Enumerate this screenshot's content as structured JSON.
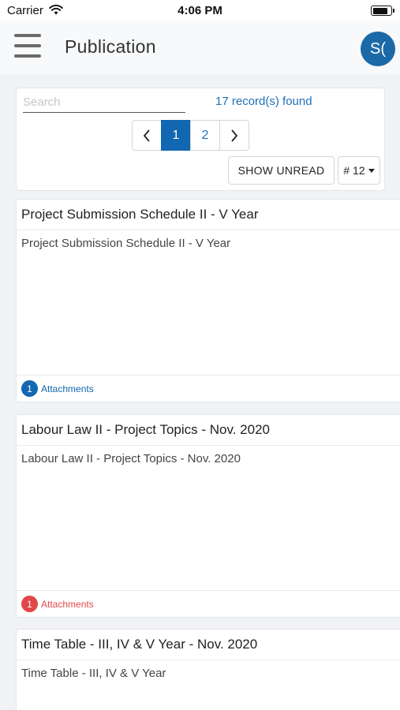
{
  "status_bar": {
    "carrier": "Carrier",
    "time": "4:06 PM",
    "battery_level": 0.9
  },
  "app_bar": {
    "title": "Publication",
    "avatar_text": "S("
  },
  "filter": {
    "search_placeholder": "Search",
    "search_value": "",
    "records_found": "17 record(s) found",
    "pager": {
      "prev": "‹",
      "pages": [
        "1",
        "2"
      ],
      "current_page": "1",
      "next": "›"
    },
    "show_unread_label": "SHOW UNREAD",
    "page_size_label": "# 12"
  },
  "publications": [
    {
      "title": "Project Submission Schedule II - V Year",
      "description": "Project Submission Schedule II - V Year",
      "attachment_count": "1",
      "attachments_label": "Attachments",
      "status_color": "#1167b1"
    },
    {
      "title": "Labour Law II - Project Topics - Nov. 2020",
      "description": "Labour Law II - Project Topics - Nov. 2020",
      "attachment_count": "1",
      "attachments_label": "Attachments",
      "status_color": "#e04848"
    },
    {
      "title": "Time Table - III, IV & V Year - Nov. 2020",
      "description": "Time Table - III, IV & V Year"
    }
  ],
  "colors": {
    "accent": "#1167b1",
    "unread": "#e04848",
    "link": "#1f70b8"
  },
  "icons": {
    "menu": "hamburger-menu-icon",
    "wifi": "wifi-icon",
    "battery": "battery-icon"
  }
}
